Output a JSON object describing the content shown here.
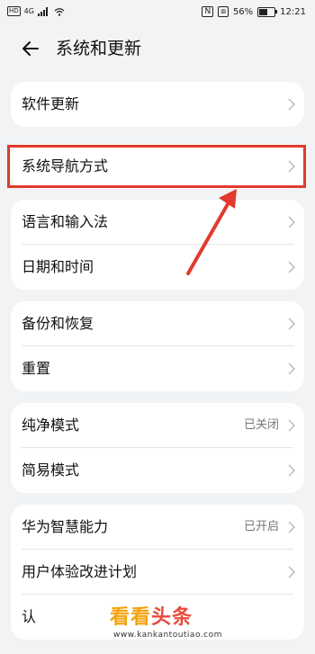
{
  "status_bar": {
    "hd": "HD",
    "network": "4G",
    "nfc": "N",
    "vibrate": "⧈",
    "battery_percent": "56%",
    "time": "12:21",
    "battery_level": 0.56
  },
  "header": {
    "title": "系统和更新",
    "back_icon": "arrow-left-icon"
  },
  "groups": [
    {
      "items": [
        {
          "label": "软件更新",
          "value": ""
        }
      ]
    },
    {
      "items": [
        {
          "label": "系统导航方式",
          "value": ""
        }
      ]
    },
    {
      "items": [
        {
          "label": "语言和输入法",
          "value": ""
        },
        {
          "label": "日期和时间",
          "value": ""
        }
      ]
    },
    {
      "items": [
        {
          "label": "备份和恢复",
          "value": ""
        },
        {
          "label": "重置",
          "value": ""
        }
      ]
    },
    {
      "items": [
        {
          "label": "纯净模式",
          "value": "已关闭"
        },
        {
          "label": "简易模式",
          "value": ""
        }
      ]
    },
    {
      "items": [
        {
          "label": "华为智慧能力",
          "value": "已开启"
        },
        {
          "label": "用户体验改进计划",
          "value": ""
        },
        {
          "label": "认",
          "value": ""
        }
      ]
    }
  ],
  "annotation": {
    "highlight_color": "#e13a2e"
  },
  "watermark": {
    "part1": "看",
    "part2": "看",
    "part3": "头条",
    "url": "www.kankantoutiao.com"
  }
}
